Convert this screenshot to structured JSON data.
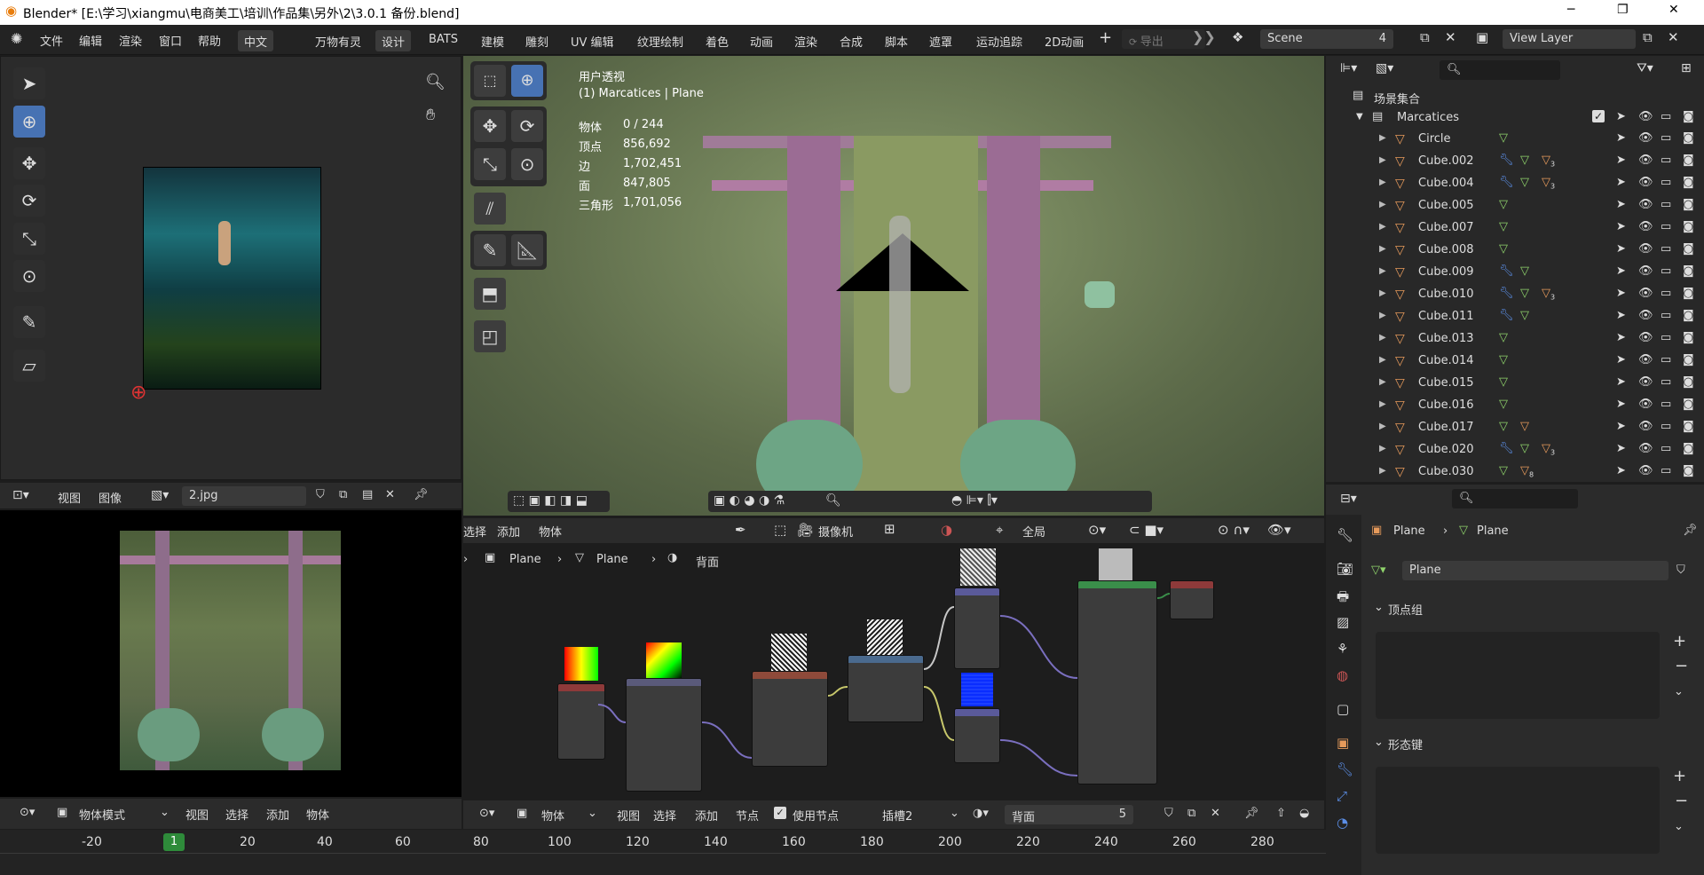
{
  "window": {
    "title": "Blender* [E:\\学习\\xiangmu\\电商美工\\培训\\作品集\\另外\\2\\3.0.1 备份.blend]",
    "controls": [
      "─",
      "❐",
      "✕"
    ]
  },
  "menubar": {
    "items": [
      "文件",
      "编辑",
      "渲染",
      "窗口",
      "帮助",
      "中文"
    ],
    "workspaces": [
      "万物有灵",
      "设计",
      "BATS",
      "建模",
      "雕刻",
      "UV 编辑",
      "纹理绘制",
      "着色",
      "动画",
      "渲染",
      "合成",
      "脚本",
      "遮罩",
      "运动追踪",
      "2D动画"
    ],
    "active_workspace": "设计",
    "export_label": "导出",
    "scene_label": "Scene",
    "scene_users": "4",
    "view_layer_label": "View Layer"
  },
  "image_editor_top": {
    "view_menu": "视图",
    "image_menu": "图像",
    "image_name": "2.jpg"
  },
  "viewport": {
    "title": "用户透视",
    "subtitle": "(1) Marcatices | Plane",
    "stats": [
      {
        "label": "物体",
        "value": "0 / 244"
      },
      {
        "label": "顶点",
        "value": "856,692"
      },
      {
        "label": "边",
        "value": "1,702,451"
      },
      {
        "label": "面",
        "value": "847,805"
      },
      {
        "label": "三角形",
        "value": "1,701,056"
      }
    ]
  },
  "outliner": {
    "root": "场景集合",
    "collection": "Marcatices",
    "objects": [
      {
        "name": "Circle",
        "modifiers": false,
        "mats": ""
      },
      {
        "name": "Cube.002",
        "modifiers": true,
        "mats": "3"
      },
      {
        "name": "Cube.004",
        "modifiers": true,
        "mats": "3"
      },
      {
        "name": "Cube.005",
        "modifiers": false,
        "mats": ""
      },
      {
        "name": "Cube.007",
        "modifiers": false,
        "mats": ""
      },
      {
        "name": "Cube.008",
        "modifiers": false,
        "mats": ""
      },
      {
        "name": "Cube.009",
        "modifiers": true,
        "mats": ""
      },
      {
        "name": "Cube.010",
        "modifiers": true,
        "mats": "3"
      },
      {
        "name": "Cube.011",
        "modifiers": true,
        "mats": ""
      },
      {
        "name": "Cube.013",
        "modifiers": false,
        "mats": ""
      },
      {
        "name": "Cube.014",
        "modifiers": false,
        "mats": ""
      },
      {
        "name": "Cube.015",
        "modifiers": false,
        "mats": ""
      },
      {
        "name": "Cube.016",
        "modifiers": false,
        "mats": ""
      },
      {
        "name": "Cube.017",
        "modifiers": false,
        "mats": " "
      },
      {
        "name": "Cube.020",
        "modifiers": true,
        "mats": "3"
      },
      {
        "name": "Cube.030",
        "modifiers": false,
        "mats": "8"
      }
    ]
  },
  "node_editor": {
    "header_menus": [
      "选择",
      "添加",
      "物体"
    ],
    "camera_label": "摄像机",
    "global_label": "全局",
    "breadcrumb": [
      "Plane",
      "Plane",
      "背面"
    ],
    "footer": {
      "object_label": "物体",
      "menus": [
        "视图",
        "选择",
        "添加",
        "节点"
      ],
      "use_nodes_label": "使用节点",
      "slot_label": "插槽2",
      "material_name": "背面",
      "material_users": "5"
    }
  },
  "viewport_bottom_header": {
    "mode": "物体模式",
    "menus": [
      "视图",
      "选择",
      "添加",
      "物体"
    ]
  },
  "properties": {
    "breadcrumb": [
      "Plane",
      "Plane"
    ],
    "mesh_name": "Plane",
    "sections": [
      "顶点组",
      "形态键"
    ]
  },
  "timeline": {
    "current_frame": "1",
    "ticks": [
      "-20",
      "20",
      "40",
      "60",
      "80",
      "100",
      "120",
      "140",
      "160",
      "180",
      "200",
      "220",
      "240",
      "260",
      "280"
    ]
  },
  "colors": {
    "accent": "#4772b3",
    "bg_dark": "#1d1d1d",
    "viewport_bg": "#5d6b4a",
    "mesh_icon": "#e69a5b",
    "frame_green": "#2e8b3a"
  }
}
